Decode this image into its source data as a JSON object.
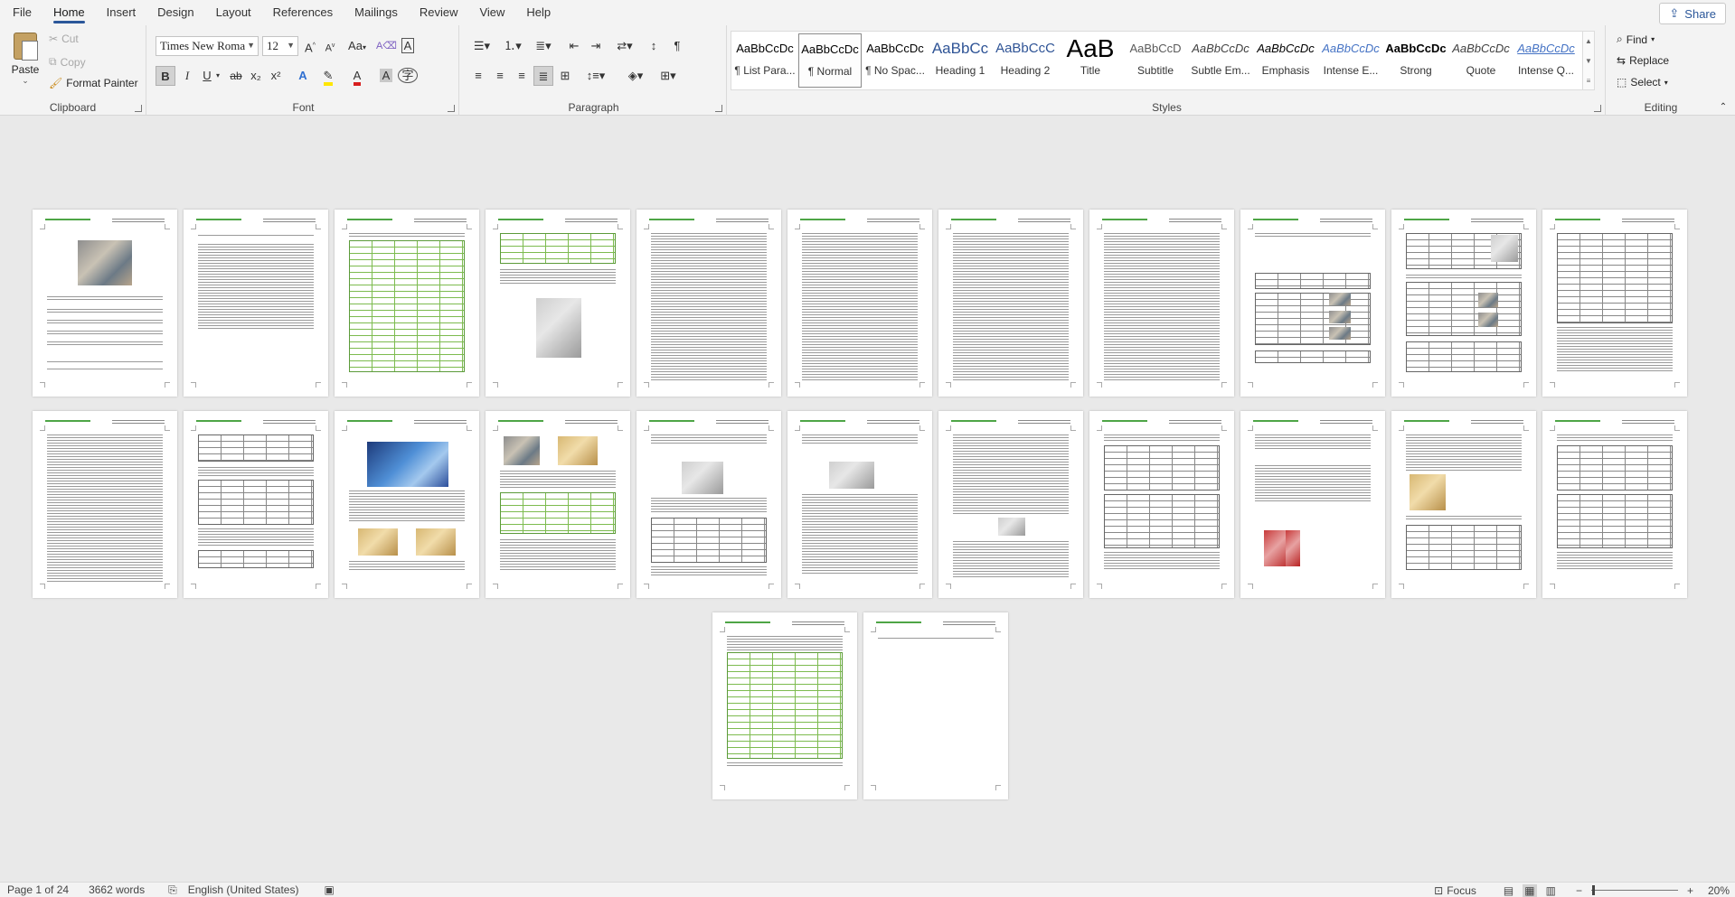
{
  "menu": {
    "tabs": [
      "File",
      "Home",
      "Insert",
      "Design",
      "Layout",
      "References",
      "Mailings",
      "Review",
      "View",
      "Help"
    ],
    "active": "Home",
    "share_label": "Share"
  },
  "clipboard": {
    "paste": "Paste",
    "cut": "Cut",
    "copy": "Copy",
    "format_painter": "Format Painter",
    "group_label": "Clipboard"
  },
  "font": {
    "family": "Times New Roma",
    "size": "12",
    "group_label": "Font",
    "bold": "B",
    "italic": "I",
    "underline": "U",
    "strike": "ab",
    "subscript": "x₂",
    "superscript": "x²",
    "change_case": "Aa",
    "grow": "A",
    "shrink": "A"
  },
  "paragraph": {
    "group_label": "Paragraph",
    "pilcrow": "¶"
  },
  "styles": {
    "group_label": "Styles",
    "items": [
      {
        "preview": "AaBbCcDc",
        "name": "¶ List Para..."
      },
      {
        "preview": "AaBbCcDc",
        "name": "¶ Normal"
      },
      {
        "preview": "AaBbCcDc",
        "name": "¶ No Spac..."
      },
      {
        "preview": "AaBbCc",
        "name": "Heading 1"
      },
      {
        "preview": "AaBbCcC",
        "name": "Heading 2"
      },
      {
        "preview": "AaB",
        "name": "Title"
      },
      {
        "preview": "AaBbCcD",
        "name": "Subtitle"
      },
      {
        "preview": "AaBbCcDc",
        "name": "Subtle Em..."
      },
      {
        "preview": "AaBbCcDc",
        "name": "Emphasis"
      },
      {
        "preview": "AaBbCcDc",
        "name": "Intense E..."
      },
      {
        "preview": "AaBbCcDc",
        "name": "Strong"
      },
      {
        "preview": "AaBbCcDc",
        "name": "Quote"
      },
      {
        "preview": "AaBbCcDc",
        "name": "Intense Q..."
      }
    ],
    "selected_index": 1
  },
  "editing": {
    "group_label": "Editing",
    "find": "Find",
    "replace": "Replace",
    "select": "Select"
  },
  "status": {
    "page": "Page 1 of 24",
    "words": "3662 words",
    "language": "English (United States)",
    "focus": "Focus",
    "zoom": "20%",
    "zoom_level": 0.2
  },
  "document": {
    "page_count": 24,
    "pages": [
      {
        "kind": "cover"
      },
      {
        "kind": "toc"
      },
      {
        "kind": "green-table"
      },
      {
        "kind": "certificate"
      },
      {
        "kind": "text"
      },
      {
        "kind": "text"
      },
      {
        "kind": "text"
      },
      {
        "kind": "text"
      },
      {
        "kind": "photos-table"
      },
      {
        "kind": "table-photo"
      },
      {
        "kind": "table-text"
      },
      {
        "kind": "text"
      },
      {
        "kind": "tables-diagram"
      },
      {
        "kind": "screen-photo"
      },
      {
        "kind": "photos-green-table"
      },
      {
        "kind": "photo-table"
      },
      {
        "kind": "machine-text"
      },
      {
        "kind": "text-photo"
      },
      {
        "kind": "tables"
      },
      {
        "kind": "text-machines"
      },
      {
        "kind": "machine-table"
      },
      {
        "kind": "tables"
      },
      {
        "kind": "big-table"
      },
      {
        "kind": "blank"
      }
    ]
  }
}
